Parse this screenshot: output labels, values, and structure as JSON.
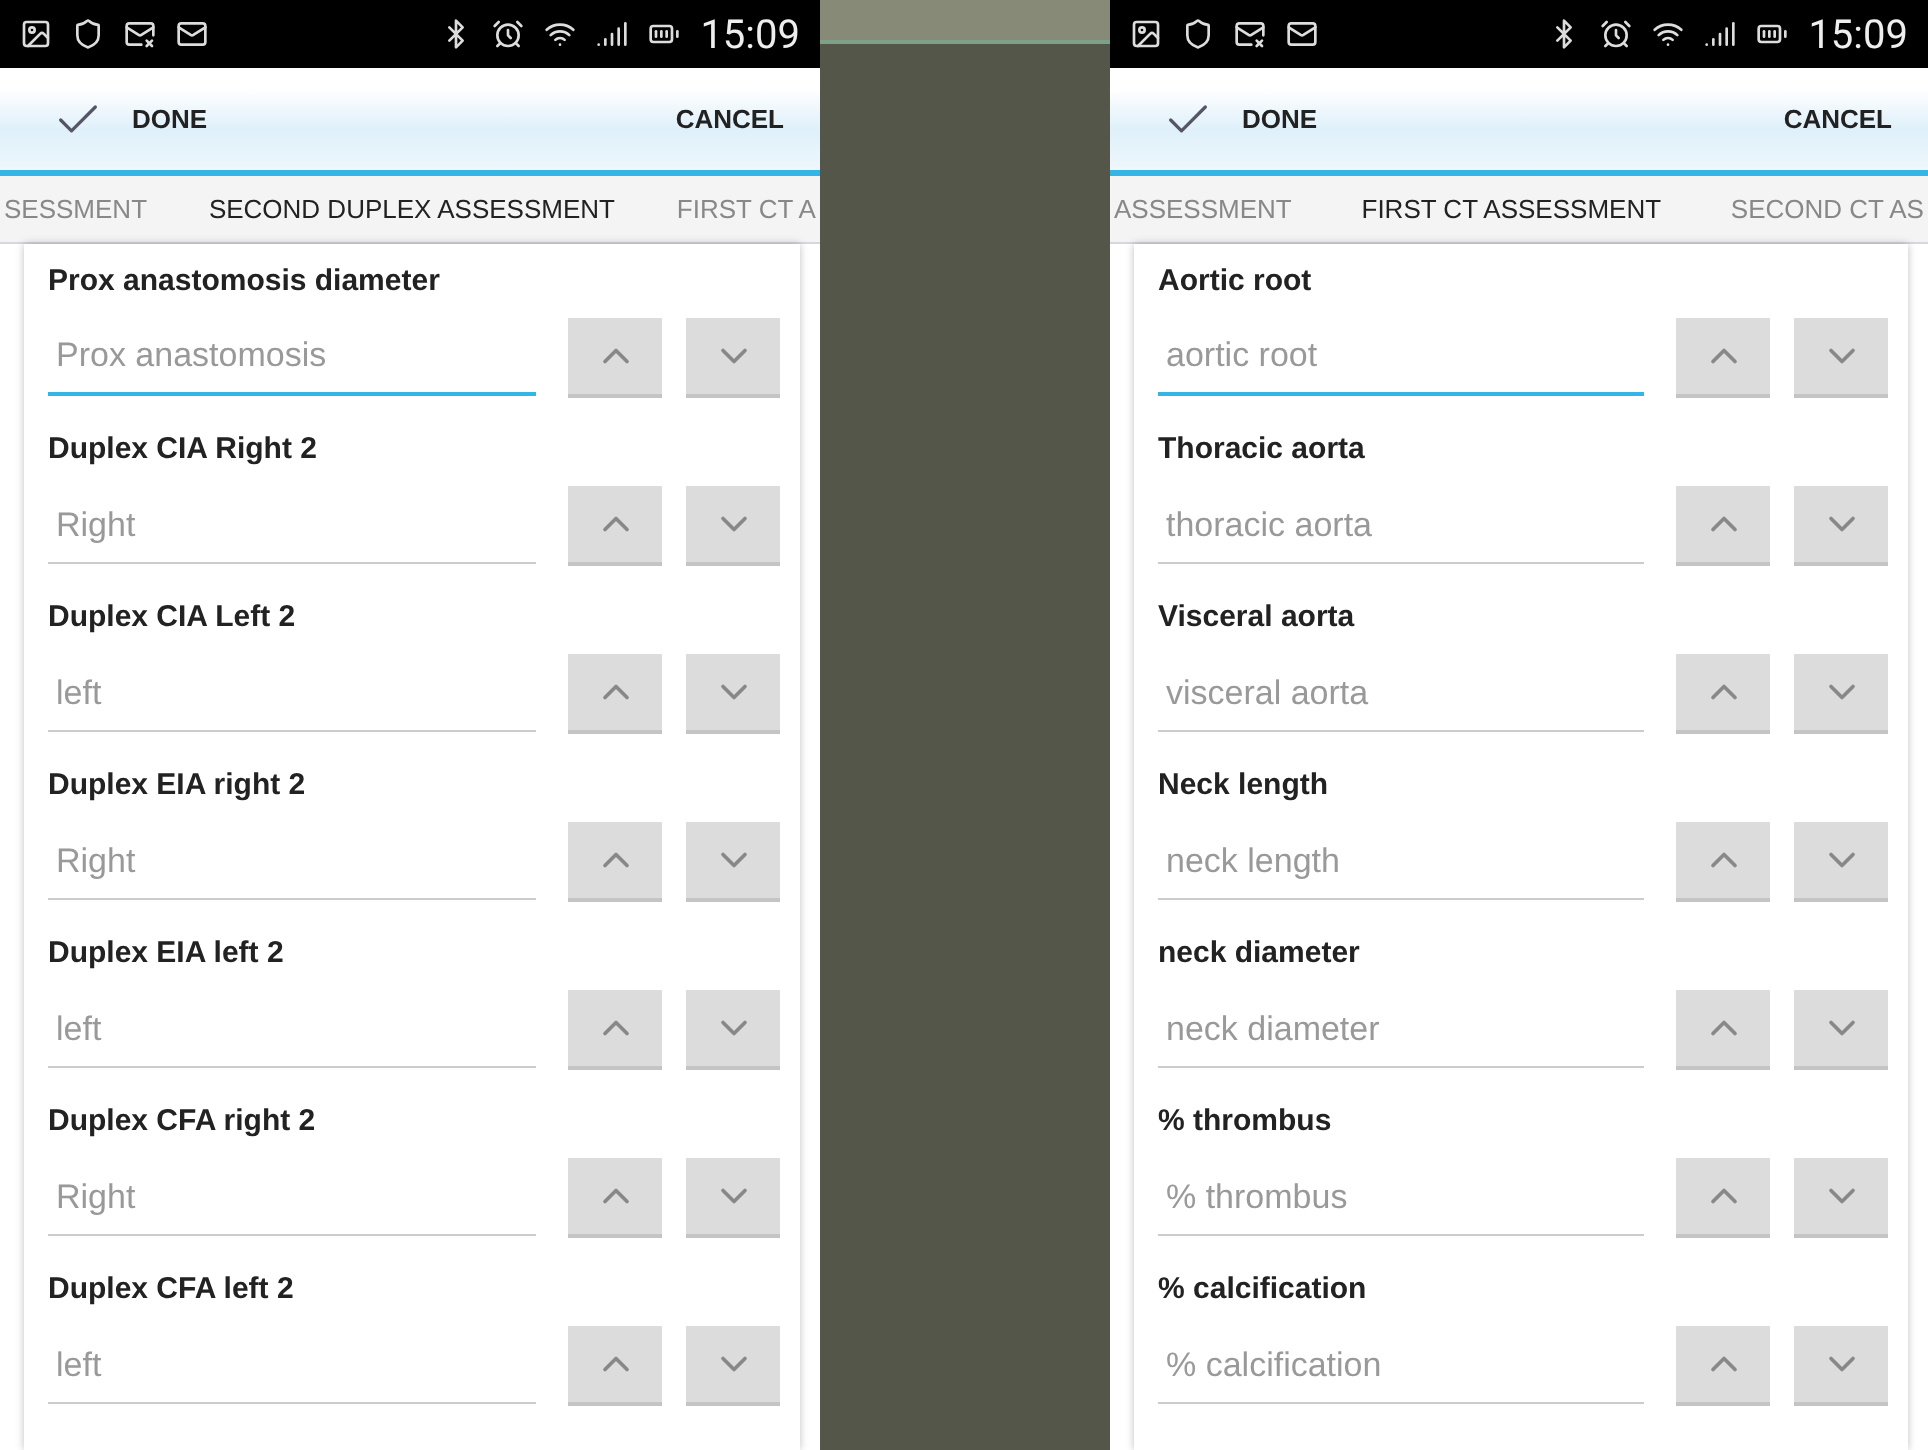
{
  "screens": [
    {
      "status_time": "15:09",
      "header": {
        "done": "DONE",
        "cancel": "CANCEL"
      },
      "tabs": [
        {
          "label": "SESSMENT",
          "selected": false
        },
        {
          "label": "SECOND DUPLEX ASSESSMENT",
          "selected": true
        },
        {
          "label": "FIRST CT A",
          "selected": false
        }
      ],
      "fields": [
        {
          "label": "Prox anastomosis diameter",
          "placeholder": "Prox anastomosis",
          "focused": true
        },
        {
          "label": "Duplex CIA Right 2",
          "placeholder": "Right",
          "focused": false
        },
        {
          "label": "Duplex CIA Left 2",
          "placeholder": "left",
          "focused": false
        },
        {
          "label": "Duplex EIA right 2",
          "placeholder": "Right",
          "focused": false
        },
        {
          "label": "Duplex EIA left 2",
          "placeholder": "left",
          "focused": false
        },
        {
          "label": "Duplex CFA right 2",
          "placeholder": "Right",
          "focused": false
        },
        {
          "label": "Duplex CFA left 2",
          "placeholder": "left",
          "focused": false
        }
      ]
    },
    {
      "status_time": "15:09",
      "header": {
        "done": "DONE",
        "cancel": "CANCEL"
      },
      "tabs": [
        {
          "label": "ASSESSMENT",
          "selected": false
        },
        {
          "label": "FIRST CT ASSESSMENT",
          "selected": true
        },
        {
          "label": "SECOND CT AS",
          "selected": false
        }
      ],
      "fields": [
        {
          "label": "Aortic root",
          "placeholder": "aortic root",
          "focused": true
        },
        {
          "label": "Thoracic aorta",
          "placeholder": "thoracic aorta",
          "focused": false
        },
        {
          "label": "Visceral aorta",
          "placeholder": "visceral aorta",
          "focused": false
        },
        {
          "label": "Neck length",
          "placeholder": "neck length",
          "focused": false
        },
        {
          "label": "neck diameter",
          "placeholder": "neck diameter",
          "focused": false
        },
        {
          "label": "% thrombus",
          "placeholder": "% thrombus",
          "focused": false
        },
        {
          "label": "% calcification",
          "placeholder": "% calcification",
          "focused": false
        }
      ]
    }
  ]
}
